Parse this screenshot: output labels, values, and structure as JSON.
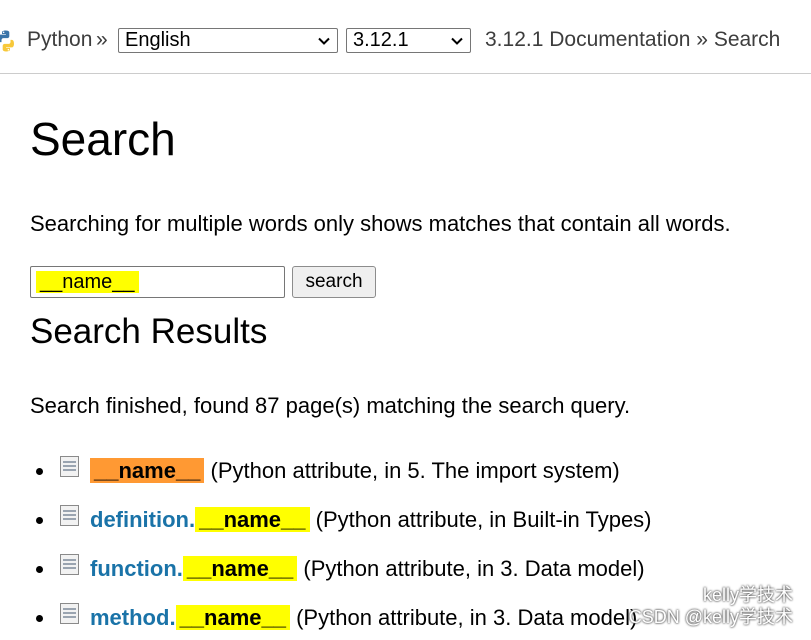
{
  "breadcrumb": {
    "python_label": "Python",
    "separator": "»",
    "language_select": "English",
    "version_select": "3.12.1",
    "doc_label": "3.12.1 Documentation » Search"
  },
  "page": {
    "title": "Search",
    "note": "Searching for multiple words only shows matches that contain all words.",
    "search_value": "__name__",
    "search_button": "search",
    "results_heading": "Search Results",
    "status": "Search finished, found 87 page(s) matching the search query."
  },
  "results": [
    {
      "prefix": "",
      "match": "__name__",
      "highlight": "#ff9933",
      "desc": "(Python attribute, in 5. The import system)"
    },
    {
      "prefix": "definition.",
      "match": "__name__",
      "highlight": "#ffff00",
      "desc": "(Python attribute, in Built-in Types)"
    },
    {
      "prefix": "function.",
      "match": "__name__",
      "highlight": "#ffff00",
      "desc": "(Python attribute, in 3. Data model)"
    },
    {
      "prefix": "method.",
      "match": "__name__",
      "highlight": "#ffff00",
      "desc": "(Python attribute, in 3. Data model)"
    }
  ],
  "watermark": {
    "line1": "kelly学技术",
    "line2": "CSDN @kelly学技术"
  },
  "colors": {
    "link": "#1a73a8",
    "highlight": "#ffff00",
    "active_highlight": "#ff9933"
  },
  "icons": {
    "logo": "python-logo-icon",
    "result": "file-icon",
    "select": "chevron-down-icon"
  }
}
